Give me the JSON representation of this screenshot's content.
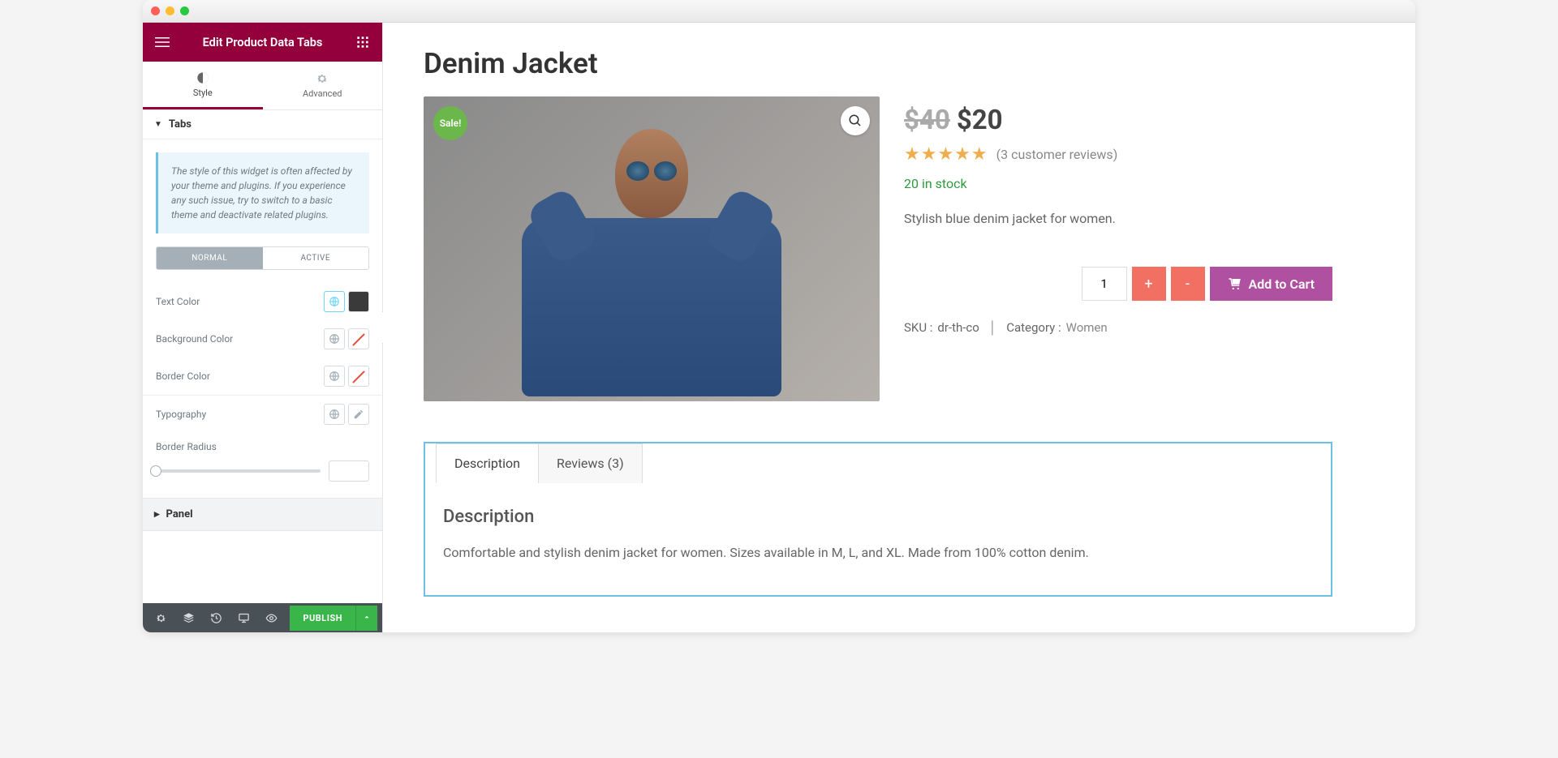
{
  "header": {
    "title": "Edit Product Data Tabs"
  },
  "tabs": {
    "style": "Style",
    "advanced": "Advanced"
  },
  "sections": {
    "tabs_label": "Tabs",
    "panel_label": "Panel"
  },
  "notice": "The style of this widget is often affected by your theme and plugins. If you experience any such issue, try to switch to a basic theme and deactivate related plugins.",
  "state": {
    "normal": "Normal",
    "active": "Active"
  },
  "controls": {
    "text_color": "Text Color",
    "background_color": "Background Color",
    "border_color": "Border Color",
    "typography": "Typography",
    "border_radius": "Border Radius"
  },
  "colors": {
    "text_color_value": "#3a3a3a"
  },
  "footer": {
    "publish": "Publish"
  },
  "product": {
    "title": "Denim Jacket",
    "sale_badge": "Sale!",
    "price_old": "$40",
    "price_new": "$20",
    "reviews_link": "(3 customer reviews)",
    "stock": "20 in stock",
    "short_desc": "Stylish blue denim jacket for women.",
    "qty": "1",
    "plus": "+",
    "minus": "-",
    "add_to_cart": "Add to Cart",
    "sku_label": "SKU :",
    "sku_value": "dr-th-co",
    "category_label": "Category :",
    "category_value": "Women"
  },
  "data_tabs": {
    "description_tab": "Description",
    "reviews_tab": "Reviews (3)",
    "description_heading": "Description",
    "description_body": "Comfortable and stylish denim jacket for women. Sizes available in M, L, and XL. Made from 100% cotton denim."
  }
}
